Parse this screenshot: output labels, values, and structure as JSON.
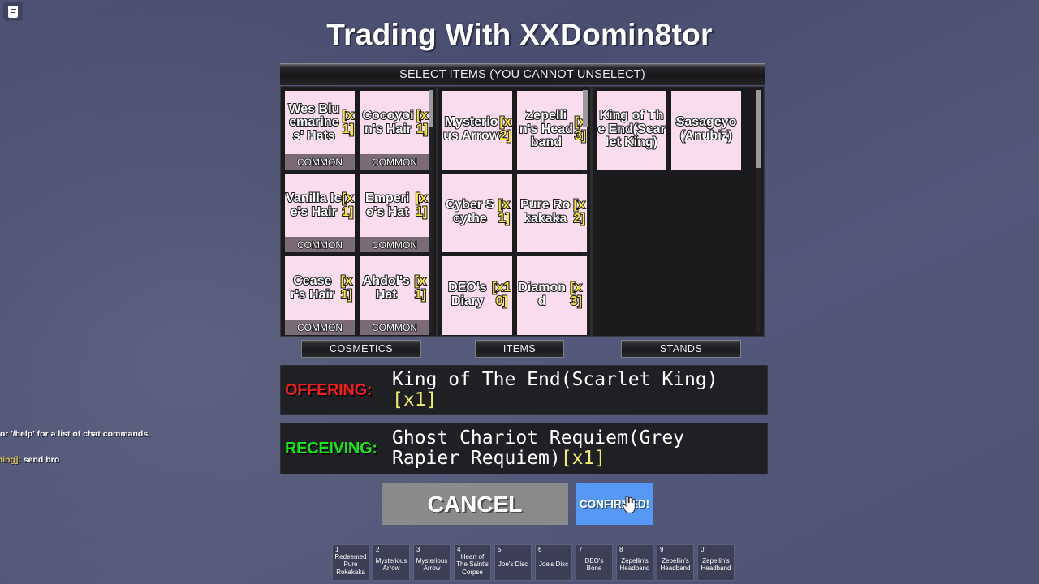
{
  "chat": {
    "toggle_icon": "chat-document-icon",
    "lines": [
      "?' or '/help' for a list of chat commands.",
      ""
    ],
    "message_speaker": "aming]:",
    "message_text": " send bro"
  },
  "header": {
    "title": "Trading With XXDomin8tor",
    "select_banner": "SELECT ITEMS (YOU CANNOT UNSELECT)"
  },
  "grid": {
    "columns": [
      {
        "key": "cosmetics",
        "items": [
          {
            "name": "Wes Bluemarines' Hats",
            "qty": "[x1]",
            "rarity": "COMMON"
          },
          {
            "name": "Cocoyoin's Hair",
            "qty": "[x1]",
            "rarity": "COMMON"
          },
          {
            "name": "Vanilla Ice's Hair",
            "qty": "[x1]",
            "rarity": "COMMON"
          },
          {
            "name": "Emperio's Hat",
            "qty": "[x1]",
            "rarity": "COMMON"
          },
          {
            "name": "Ceaser's Hair",
            "qty": "[x1]",
            "rarity": "COMMON"
          },
          {
            "name": "Ahdol's Hat",
            "qty": "[x1]",
            "rarity": "COMMON"
          }
        ]
      },
      {
        "key": "items",
        "items": [
          {
            "name": "Mysterious Arrow",
            "qty": "[x2]",
            "rarity": ""
          },
          {
            "name": "Zepellin's Headband",
            "qty": "[x3]",
            "rarity": ""
          },
          {
            "name": "Cyber Scythe",
            "qty": "[x1]",
            "rarity": ""
          },
          {
            "name": "Pure Rokakaka",
            "qty": "[x2]",
            "rarity": ""
          },
          {
            "name": "DEO's Diary",
            "qty": "[x10]",
            "rarity": ""
          },
          {
            "name": "Diamond",
            "qty": "[x3]",
            "rarity": ""
          }
        ]
      },
      {
        "key": "stands",
        "items": [
          {
            "name": "King of The End(Scarlet King)",
            "qty": "",
            "rarity": ""
          },
          {
            "name": "Sasageyo(Anubiz)",
            "qty": "",
            "rarity": ""
          }
        ]
      }
    ]
  },
  "tabs": [
    {
      "label": "COSMETICS"
    },
    {
      "label": "ITEMS"
    },
    {
      "label": "STANDS"
    }
  ],
  "trade": {
    "offering_label": "OFFERING:",
    "offering_value": "King of The End(Scarlet King)",
    "offering_qty": "[x1]",
    "receiving_label": "RECEIVING:",
    "receiving_value": "Ghost Chariot Requiem(Grey Rapier Requiem)",
    "receiving_qty": "[x1]"
  },
  "actions": {
    "cancel_label": "CANCEL",
    "confirm_label": "CONFIRMED!",
    "confirm_color": "#5699f5",
    "cursor_icon": "hand-pointer-cursor"
  },
  "hotbar": [
    {
      "key": "1",
      "name": "Redeemed Pure Rokakaka"
    },
    {
      "key": "2",
      "name": "Mysterious Arrow"
    },
    {
      "key": "3",
      "name": "Mysterious Arrow"
    },
    {
      "key": "4",
      "name": "Heart of The Saint's Corpse"
    },
    {
      "key": "5",
      "name": "Joe's Disc"
    },
    {
      "key": "6",
      "name": "Joe's Disc"
    },
    {
      "key": "7",
      "name": "DEO's Bone"
    },
    {
      "key": "8",
      "name": "Zepellin's Headband"
    },
    {
      "key": "9",
      "name": "Zepellin's Headband"
    },
    {
      "key": "0",
      "name": "Zepellin's Headband"
    }
  ]
}
